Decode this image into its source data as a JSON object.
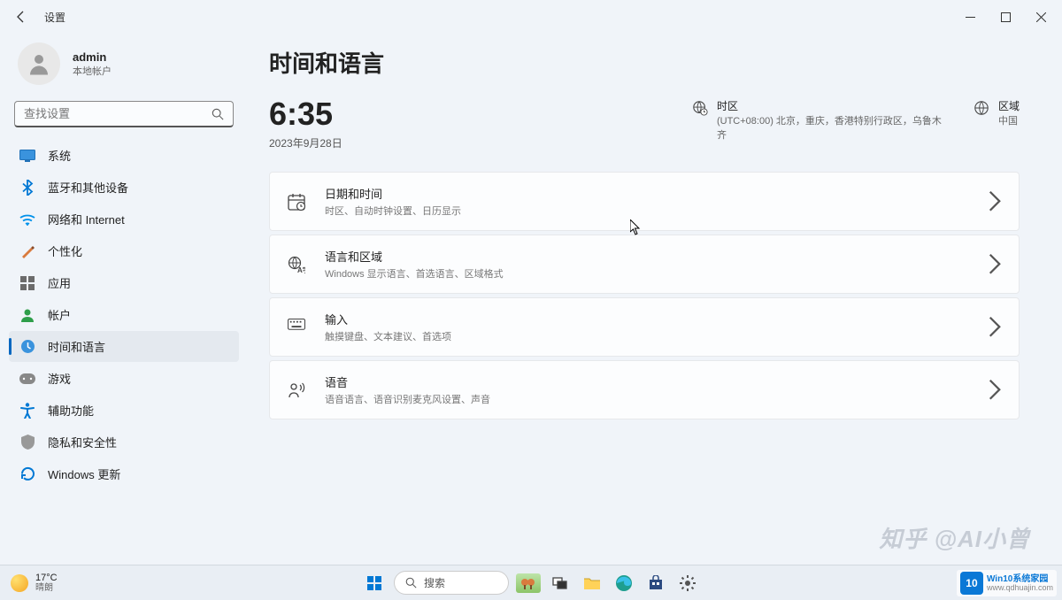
{
  "titlebar": {
    "app_name": "设置"
  },
  "profile": {
    "name": "admin",
    "subtitle": "本地帐户"
  },
  "search": {
    "placeholder": "查找设置"
  },
  "nav": [
    {
      "id": "system",
      "label": "系统",
      "color": "#0067c0"
    },
    {
      "id": "bluetooth",
      "label": "蓝牙和其他设备",
      "color": "#0067c0"
    },
    {
      "id": "network",
      "label": "网络和 Internet",
      "color": "#0067c0"
    },
    {
      "id": "personalization",
      "label": "个性化",
      "color": "#c45b1d"
    },
    {
      "id": "apps",
      "label": "应用",
      "color": "#5a5a5a"
    },
    {
      "id": "accounts",
      "label": "帐户",
      "color": "#107c10"
    },
    {
      "id": "time-language",
      "label": "时间和语言",
      "color": "#0067c0",
      "active": true
    },
    {
      "id": "gaming",
      "label": "游戏",
      "color": "#888"
    },
    {
      "id": "accessibility",
      "label": "辅助功能",
      "color": "#0067c0"
    },
    {
      "id": "privacy",
      "label": "隐私和安全性",
      "color": "#888"
    },
    {
      "id": "update",
      "label": "Windows 更新",
      "color": "#0067c0"
    }
  ],
  "page": {
    "title": "时间和语言",
    "time": "6:35",
    "date": "2023年9月28日",
    "timezone": {
      "label": "时区",
      "value": "(UTC+08:00) 北京，重庆，香港特别行政区，乌鲁木齐"
    },
    "region": {
      "label": "区域",
      "value": "中国"
    }
  },
  "cards": [
    {
      "id": "date-time",
      "title": "日期和时间",
      "subtitle": "时区、自动时钟设置、日历显示"
    },
    {
      "id": "language-region",
      "title": "语言和区域",
      "subtitle": "Windows 显示语言、首选语言、区域格式"
    },
    {
      "id": "typing",
      "title": "输入",
      "subtitle": "触摸键盘、文本建议、首选项"
    },
    {
      "id": "speech",
      "title": "语音",
      "subtitle": "语音语言、语音识别麦克风设置、声音"
    }
  ],
  "taskbar": {
    "weather": {
      "temp": "17°C",
      "condition": "晴朗"
    },
    "search": "搜索"
  },
  "watermarks": {
    "zhihu": "知乎 @AI小曾",
    "brand": "Win10系统家园",
    "url": "www.qdhuajin.com"
  }
}
